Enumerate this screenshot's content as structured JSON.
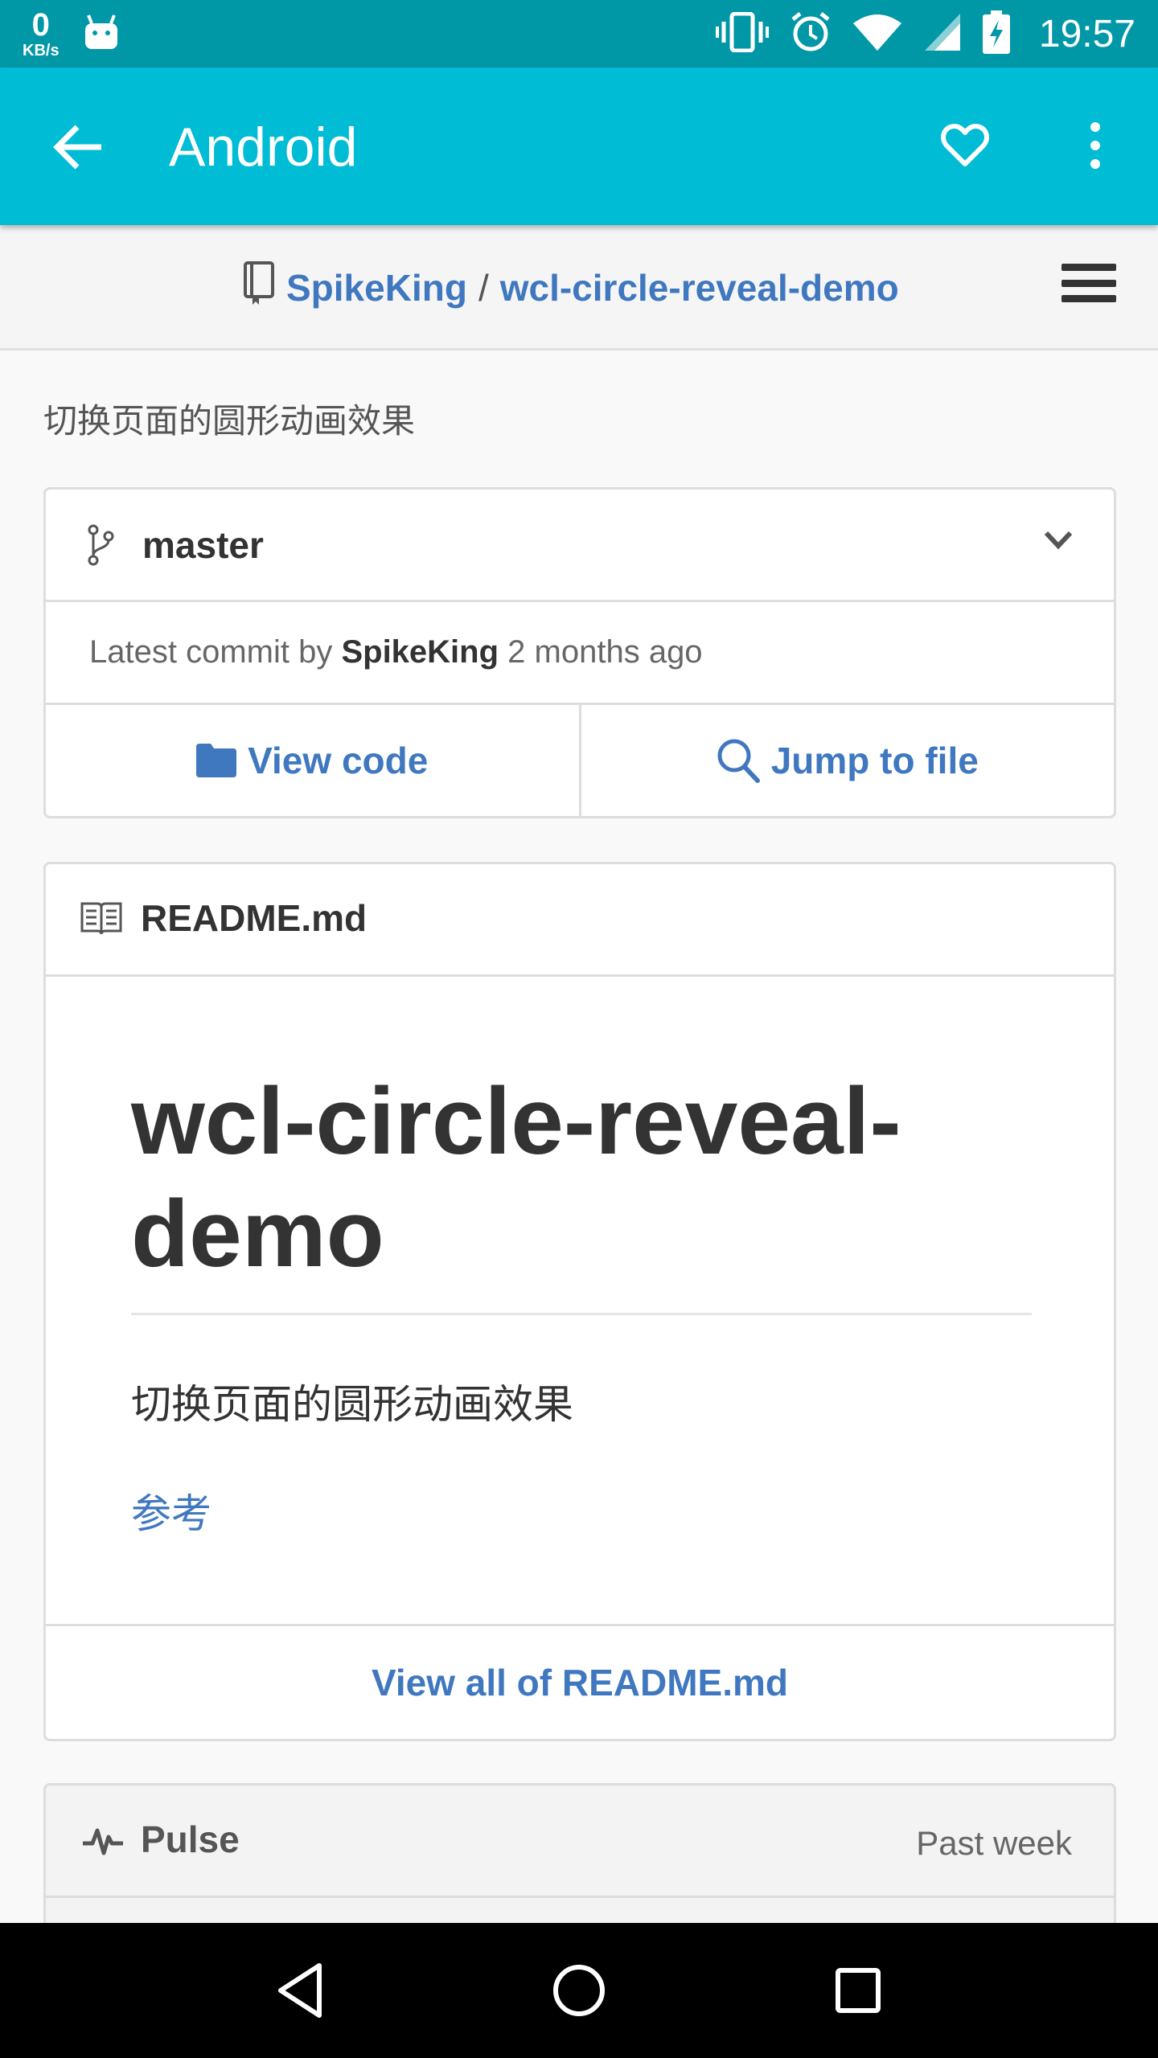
{
  "status_bar": {
    "net_speed_value": "0",
    "net_speed_unit": "KB/s",
    "time": "19:57"
  },
  "app_bar": {
    "title": "Android"
  },
  "repo": {
    "owner": "SpikeKing",
    "separator": "/",
    "name": "wcl-circle-reveal-demo",
    "description": "切换页面的圆形动画效果"
  },
  "branch": {
    "name": "master",
    "commit_prefix": "Latest commit by",
    "commit_author": "SpikeKing",
    "commit_time": "2 months ago",
    "view_code_label": "View code",
    "jump_to_file_label": "Jump to file"
  },
  "readme": {
    "filename": "README.md",
    "heading": "wcl-circle-reveal-demo",
    "paragraph": "切换页面的圆形动画效果",
    "link": "参考",
    "view_all_label": "View all of README.md"
  },
  "pulse": {
    "title": "Pulse",
    "range": "Past week"
  },
  "colors": {
    "status_bar": "#0097a7",
    "app_bar": "#00bcd4",
    "link": "#4078c0"
  }
}
